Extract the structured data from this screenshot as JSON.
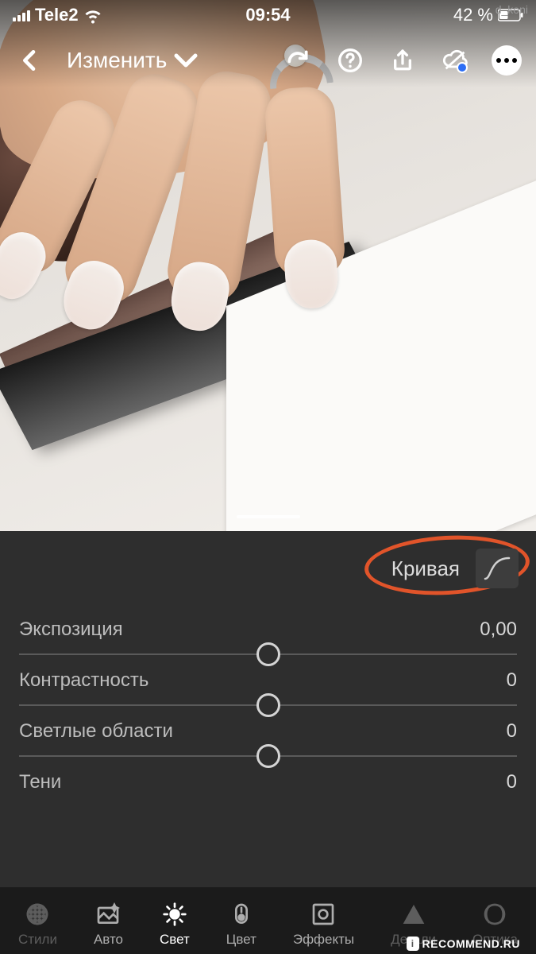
{
  "statusbar": {
    "carrier": "Tele2",
    "time": "09:54",
    "battery": "42 %"
  },
  "watermark_user": "d_koni",
  "topbar": {
    "edit_label": "Изменить"
  },
  "curve": {
    "label": "Кривая"
  },
  "sliders": [
    {
      "label": "Экспозиция",
      "value": "0,00"
    },
    {
      "label": "Контрастность",
      "value": "0"
    },
    {
      "label": "Светлые области",
      "value": "0"
    },
    {
      "label": "Тени",
      "value": "0"
    }
  ],
  "bottombar": {
    "styles": "Стили",
    "auto": "Авто",
    "light": "Свет",
    "color": "Цвет",
    "effects": "Эффекты",
    "detail": "Детали",
    "optics": "Оптика"
  },
  "watermark_site": {
    "badge": "i",
    "text": "RECOMMEND.RU"
  }
}
